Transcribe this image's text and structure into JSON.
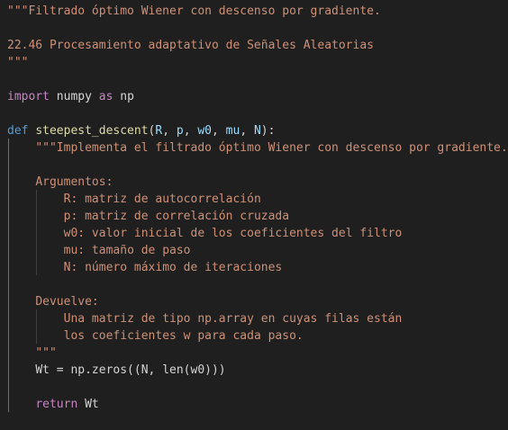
{
  "editor": {
    "lines": [
      {
        "indent": "",
        "tokens": [
          {
            "cls": "str",
            "text": "\"\"\"Filtrado óptimo Wiener con descenso por gradiente."
          }
        ]
      },
      {
        "indent": "",
        "tokens": []
      },
      {
        "indent": "",
        "tokens": [
          {
            "cls": "str",
            "text": "22.46 Procesamiento adaptativo de Señales Aleatorias"
          }
        ]
      },
      {
        "indent": "",
        "tokens": [
          {
            "cls": "str",
            "text": "\"\"\""
          }
        ]
      },
      {
        "indent": "",
        "tokens": []
      },
      {
        "indent": "",
        "tokens": [
          {
            "cls": "kw2",
            "text": "import"
          },
          {
            "cls": "plain",
            "text": " numpy "
          },
          {
            "cls": "kw2",
            "text": "as"
          },
          {
            "cls": "plain",
            "text": " np"
          }
        ]
      },
      {
        "indent": "",
        "tokens": []
      },
      {
        "indent": "",
        "tokens": [
          {
            "cls": "kw",
            "text": "def"
          },
          {
            "cls": "plain",
            "text": " "
          },
          {
            "cls": "fn",
            "text": "steepest_descent"
          },
          {
            "cls": "plain",
            "text": "("
          },
          {
            "cls": "param",
            "text": "R"
          },
          {
            "cls": "plain",
            "text": ", "
          },
          {
            "cls": "param",
            "text": "p"
          },
          {
            "cls": "plain",
            "text": ", "
          },
          {
            "cls": "param",
            "text": "w0"
          },
          {
            "cls": "plain",
            "text": ", "
          },
          {
            "cls": "param",
            "text": "mu"
          },
          {
            "cls": "plain",
            "text": ", "
          },
          {
            "cls": "param",
            "text": "N"
          },
          {
            "cls": "plain",
            "text": "):"
          }
        ]
      },
      {
        "indent": "    ",
        "tokens": [
          {
            "cls": "str",
            "text": "\"\"\"Implementa el filtrado óptimo Wiener con descenso por gradiente."
          }
        ]
      },
      {
        "indent": "",
        "tokens": []
      },
      {
        "indent": "    ",
        "tokens": [
          {
            "cls": "str",
            "text": "Argumentos:"
          }
        ]
      },
      {
        "indent": "        ",
        "tokens": [
          {
            "cls": "str",
            "text": "R: matriz de autocorrelación"
          }
        ]
      },
      {
        "indent": "        ",
        "tokens": [
          {
            "cls": "str",
            "text": "p: matriz de correlación cruzada"
          }
        ]
      },
      {
        "indent": "        ",
        "tokens": [
          {
            "cls": "str",
            "text": "w0: valor inicial de los coeficientes del filtro"
          }
        ]
      },
      {
        "indent": "        ",
        "tokens": [
          {
            "cls": "str",
            "text": "mu: tamaño de paso"
          }
        ]
      },
      {
        "indent": "        ",
        "tokens": [
          {
            "cls": "str",
            "text": "N: número máximo de iteraciones"
          }
        ]
      },
      {
        "indent": "",
        "tokens": []
      },
      {
        "indent": "    ",
        "tokens": [
          {
            "cls": "str",
            "text": "Devuelve:"
          }
        ]
      },
      {
        "indent": "        ",
        "tokens": [
          {
            "cls": "str",
            "text": "Una matriz de tipo np.array en cuyas filas están"
          }
        ]
      },
      {
        "indent": "        ",
        "tokens": [
          {
            "cls": "str",
            "text": "los coeficientes w para cada paso."
          }
        ]
      },
      {
        "indent": "    ",
        "tokens": [
          {
            "cls": "str",
            "text": "\"\"\""
          }
        ]
      },
      {
        "indent": "    ",
        "tokens": [
          {
            "cls": "plain",
            "text": "Wt = np.zeros((N, len(w0)))"
          }
        ]
      },
      {
        "indent": "",
        "tokens": []
      },
      {
        "indent": "    ",
        "tokens": [
          {
            "cls": "kw2",
            "text": "return"
          },
          {
            "cls": "plain",
            "text": " Wt"
          }
        ]
      }
    ],
    "colors": {
      "background": "#1f1f1f",
      "keyword": "#569cd6",
      "control_keyword": "#c586c0",
      "string": "#ce9178",
      "function": "#dcdcaa",
      "parameter": "#9cdcfe",
      "text": "#d4d4d4"
    }
  }
}
